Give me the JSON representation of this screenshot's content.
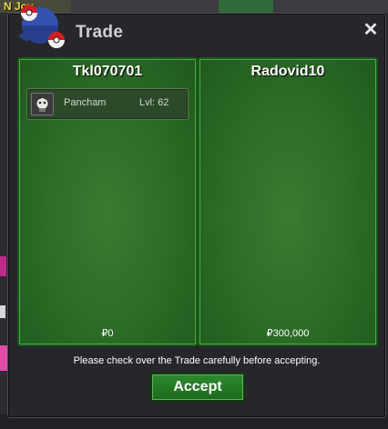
{
  "window": {
    "title": "Trade",
    "close_icon": "close-icon"
  },
  "background": {
    "player_name_fragment": "N     Joy"
  },
  "left_panel": {
    "player_name": "Tkl070701",
    "items": [
      {
        "name": "Pancham",
        "level": "Lvl: 62"
      }
    ],
    "money": "₽0"
  },
  "right_panel": {
    "player_name": "Radovid10",
    "items": [],
    "money": "₽300,000"
  },
  "footer": {
    "notice": "Please check over the Trade carefully before accepting.",
    "accept_label": "Accept"
  },
  "colors": {
    "panel_green": "#2f6d28",
    "panel_border": "#145a14",
    "window_bg": "#26262b",
    "accept_green": "#2f8a2f",
    "title_text": "#cfcfd6"
  }
}
